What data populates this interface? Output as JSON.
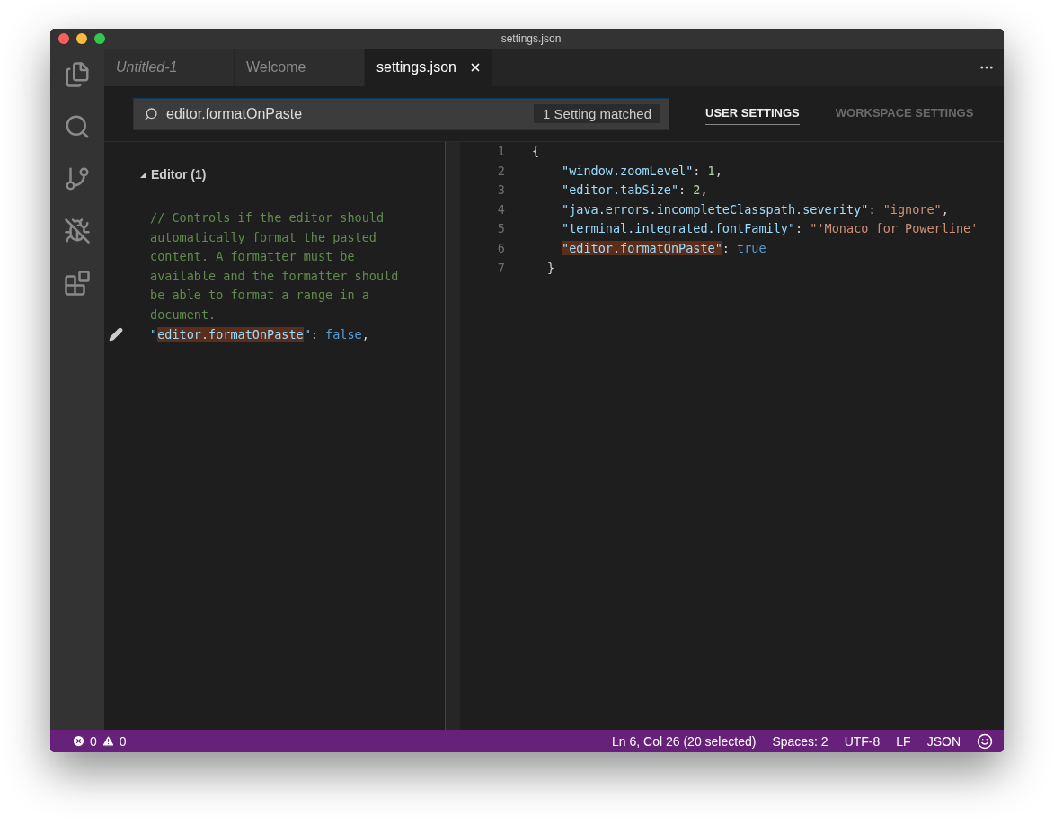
{
  "window": {
    "title": "settings.json"
  },
  "tabs": [
    {
      "label": "Untitled-1",
      "selected": false,
      "preview": true
    },
    {
      "label": "Welcome",
      "selected": false,
      "preview": false
    },
    {
      "label": "settings.json",
      "selected": true,
      "preview": false
    }
  ],
  "search": {
    "value": "editor.formatOnPaste",
    "match_count": "1 Setting matched"
  },
  "settings_tabs": [
    {
      "label": "USER SETTINGS",
      "selected": true
    },
    {
      "label": "WORKSPACE SETTINGS",
      "selected": false
    }
  ],
  "default_settings": {
    "group": {
      "label": "Editor (1)",
      "expanded": true
    },
    "comment_lines": [
      "// Controls if the editor should",
      "automatically format the pasted",
      "content. A formatter must be",
      "available and the formatter should",
      "be able to format a range in a",
      "document."
    ],
    "setting": [
      {
        "text": "\"",
        "kind": "key"
      },
      {
        "text": "editor.formatOnPaste",
        "kind": "match"
      },
      {
        "text": "\"",
        "kind": "key"
      },
      {
        "text": ": ",
        "kind": "punct"
      },
      {
        "text": "false",
        "kind": "bool"
      },
      {
        "text": ",",
        "kind": "punct"
      }
    ]
  },
  "editor": {
    "lines": [
      {
        "number": "1",
        "kind": "open",
        "tokens": [
          {
            "text": "{",
            "kind": "punct"
          }
        ]
      },
      {
        "number": "2",
        "kind": "entry",
        "tokens": [
          {
            "text": "\"window.zoomLevel\"",
            "kind": "key"
          },
          {
            "text": ": ",
            "kind": "punct"
          },
          {
            "text": "1",
            "kind": "number"
          },
          {
            "text": ",",
            "kind": "punct"
          }
        ]
      },
      {
        "number": "3",
        "kind": "entry",
        "tokens": [
          {
            "text": "\"editor.tabSize\"",
            "kind": "key"
          },
          {
            "text": ": ",
            "kind": "punct"
          },
          {
            "text": "2",
            "kind": "number"
          },
          {
            "text": ",",
            "kind": "punct"
          }
        ]
      },
      {
        "number": "4",
        "kind": "entry",
        "tokens": [
          {
            "text": "\"java.errors.incompleteClasspath.severity\"",
            "kind": "key"
          },
          {
            "text": ": ",
            "kind": "punct"
          },
          {
            "text": "\"ignore\"",
            "kind": "string"
          },
          {
            "text": ",",
            "kind": "punct"
          }
        ]
      },
      {
        "number": "5",
        "kind": "entry",
        "tokens": [
          {
            "text": "\"terminal.integrated.fontFamily\"",
            "kind": "key"
          },
          {
            "text": ": ",
            "kind": "punct"
          },
          {
            "text": "\"'Monaco for Powerline'",
            "kind": "string"
          }
        ]
      },
      {
        "number": "6",
        "kind": "entry",
        "tokens": [
          {
            "text": "\"editor.formatOnPaste\"",
            "kind": "match"
          },
          {
            "text": ": ",
            "kind": "punct"
          },
          {
            "text": "true",
            "kind": "bool"
          }
        ]
      },
      {
        "number": "7",
        "kind": "close",
        "tokens": [
          {
            "text": "}",
            "kind": "punct"
          }
        ]
      }
    ]
  },
  "status_bar": {
    "errors": "0",
    "warnings": "0",
    "items": [
      "Ln 6, Col 26 (20 selected)",
      "Spaces: 2",
      "UTF-8",
      "LF",
      "JSON"
    ]
  }
}
